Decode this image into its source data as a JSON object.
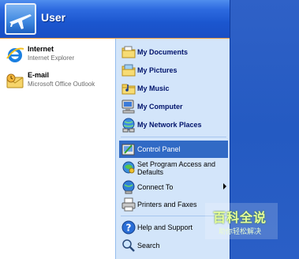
{
  "user": {
    "name": "User"
  },
  "pinned": [
    {
      "title": "Internet",
      "subtitle": "Internet Explorer",
      "icon": "internet-explorer-icon"
    },
    {
      "title": "E-mail",
      "subtitle": "Microsoft Office Outlook",
      "icon": "outlook-icon"
    }
  ],
  "places": [
    {
      "label": "My Documents",
      "icon": "folder-documents-icon"
    },
    {
      "label": "My Pictures",
      "icon": "folder-pictures-icon"
    },
    {
      "label": "My Music",
      "icon": "folder-music-icon"
    },
    {
      "label": "My Computer",
      "icon": "computer-icon"
    },
    {
      "label": "My Network Places",
      "icon": "network-icon"
    }
  ],
  "system": [
    {
      "label": "Control Panel",
      "icon": "control-panel-icon",
      "selected": true
    },
    {
      "label": "Set Program Access and Defaults",
      "icon": "program-access-icon"
    },
    {
      "label": "Connect To",
      "icon": "connect-to-icon",
      "submenu": true
    },
    {
      "label": "Printers and Faxes",
      "icon": "printer-icon"
    }
  ],
  "utilities": [
    {
      "label": "Help and Support",
      "icon": "help-icon"
    },
    {
      "label": "Search",
      "icon": "search-icon"
    }
  ],
  "watermark": {
    "title": "百科全说",
    "subtitle": "助你轻松解决"
  },
  "colors": {
    "header": "#1b56cf",
    "right_pane": "#d3e5fa",
    "selection": "#316ac5",
    "desktop": "#245ac2",
    "label_blue": "#00136b"
  }
}
